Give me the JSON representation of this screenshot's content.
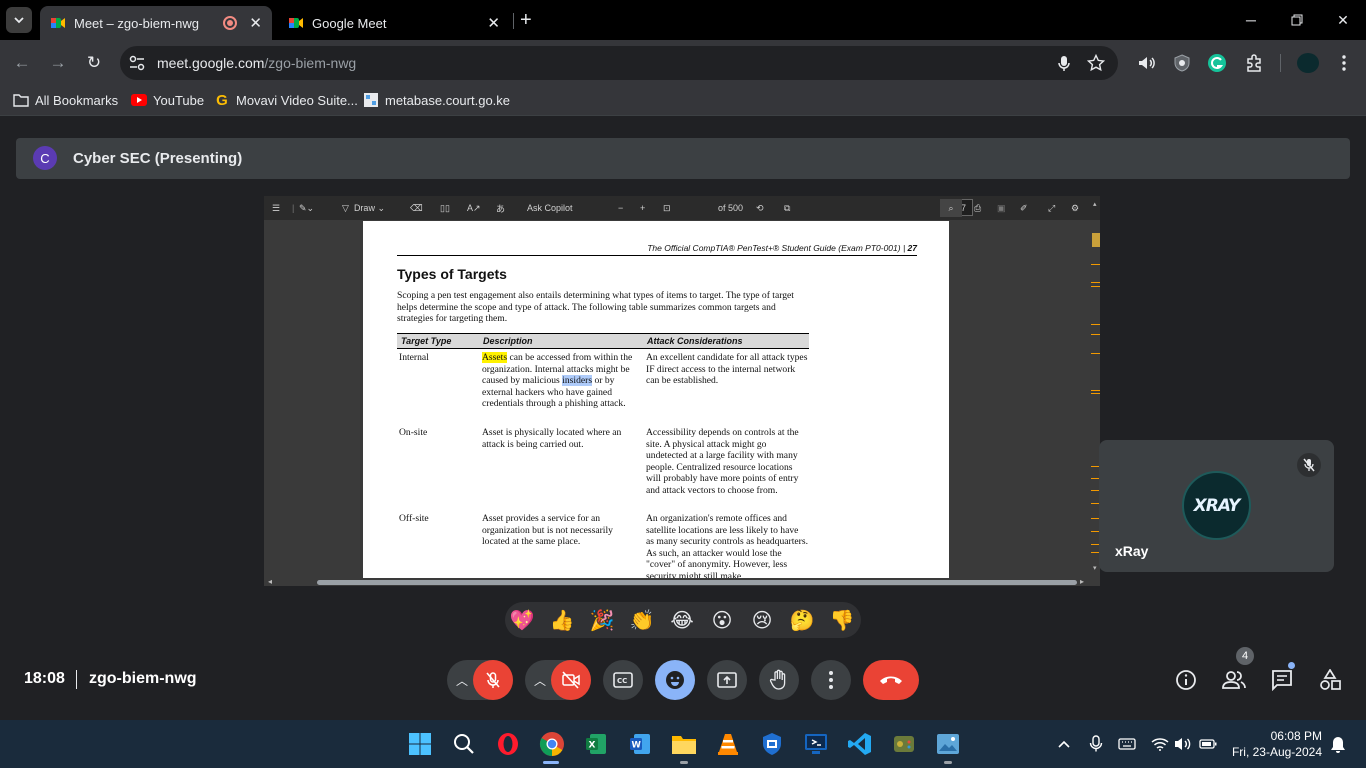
{
  "browser": {
    "tabs": [
      {
        "title": "Meet – zgo-biem-nwg",
        "active": true,
        "recording": true
      },
      {
        "title": "Google Meet",
        "active": false
      }
    ],
    "url_host": "meet.google.com",
    "url_path": "/zgo-biem-nwg",
    "bookmarks": [
      {
        "label": "All Bookmarks",
        "icon": "folder-icon"
      },
      {
        "label": "YouTube",
        "icon": "youtube-icon"
      },
      {
        "label": "Movavi Video Suite...",
        "icon": "movavi-icon"
      },
      {
        "label": "metabase.court.go.ke",
        "icon": "metabase-icon"
      }
    ]
  },
  "meet": {
    "presenter_initial": "C",
    "presenter_label": "Cyber SEC (Presenting)",
    "time": "18:08",
    "meeting_code": "zgo-biem-nwg",
    "participant_count": "4",
    "participant": {
      "name": "xRay",
      "avatar_text": "XRAY",
      "muted": true
    },
    "reactions": [
      "💖",
      "👍",
      "🎉",
      "👏",
      "😂",
      "😮",
      "😢",
      "🤔",
      "👎"
    ]
  },
  "pdf": {
    "toolbar": {
      "draw_label": "Draw",
      "copilot_label": "Ask Copilot",
      "current_page": "37",
      "total_pages": "of 500"
    },
    "running_header": "The Official CompTIA® PenTest+® Student Guide (Exam PT0-001)  |  ",
    "page_number": "27",
    "heading": "Types of Targets",
    "intro": "Scoping a pen test engagement also entails determining what types of items to target. The type of target helps determine the scope and type of attack. The following table summarizes common targets and strategies for targeting them.",
    "table": {
      "headers": [
        "Target Type",
        "Description",
        "Attack Considerations"
      ],
      "rows": [
        {
          "type": "Internal",
          "desc_highlight": "Assets",
          "desc_a": " can be accessed from within the organization. Internal attacks might be caused by malicious ",
          "desc_highlight2": "insiders",
          "desc_b": " or by external hackers who have gained credentials through a phishing attack.",
          "attack": "An excellent candidate for all attack types IF direct access to the internal network can be established."
        },
        {
          "type": "On-site",
          "desc": "Asset is physically located where an attack is being carried out.",
          "attack": "Accessibility depends on controls at the site. A physical attack might go undetected at a large facility with many people. Centralized resource locations will probably have more points of entry and attack vectors to choose from."
        },
        {
          "type": "Off-site",
          "desc": "Asset provides a service for an organization but is not necessarily located at the same place.",
          "attack": "An organization's remote offices and satellite locations are less likely to have as many security controls as headquarters. As such, an attacker would lose the \"cover\" of anonymity. However, less security might still make"
        }
      ]
    }
  },
  "taskbar": {
    "time": "06:08 PM",
    "date": "Fri, 23-Aug-2024"
  },
  "colors": {
    "end_call": "#ea4335",
    "emoji_button": "#8ab4f8",
    "highlight_yellow": "#fff200",
    "highlight_blue": "#aecbfa"
  }
}
